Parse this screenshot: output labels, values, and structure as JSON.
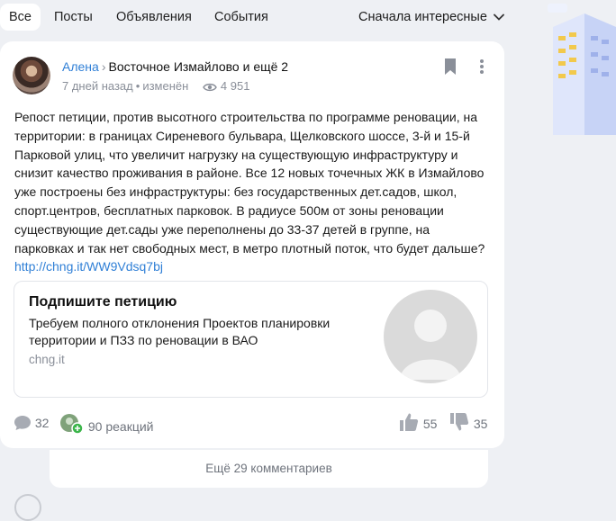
{
  "filters": {
    "tabs": [
      {
        "label": "Все",
        "active": true
      },
      {
        "label": "Посты",
        "active": false
      },
      {
        "label": "Объявления",
        "active": false
      },
      {
        "label": "События",
        "active": false
      }
    ],
    "sort_label": "Сначала интересные"
  },
  "post": {
    "author": "Алена",
    "separator": "›",
    "location": "Восточное Измайлово и ещё 2",
    "age": "7 дней назад",
    "dot": "•",
    "edited": "изменён",
    "views": "4 951",
    "text": "Репост петиции, против высотного строительства по программе реновации, на территории: в границах Сиреневого бульвара, Щелковского шоссе, 3-й и 15-й Парковой улиц, что увеличит нагрузку на существующую инфраструктуру и снизит качество проживания в районе. Все 12 новых точечных ЖК в Измайлово уже построены без инфраструктуры: без государственных дет.садов, школ, спорт.центров, бесплатных парковок. В радиусе 500м от зоны реновации существующие дет.сады уже переполнены до 33-37 детей в группе, на парковках и так нет свободных мест, в метро плотный поток, что будет дальше?",
    "link": "http://chng.it/WW9Vdsq7bj",
    "snippet": {
      "title": "Подпишите петицию",
      "description": "Требуем полного отклонения Проектов планировки территории и ПЗЗ по реновации в ВАО",
      "domain": "chng.it"
    },
    "comments_count": "32",
    "reactions_label": "90 реакций",
    "likes": "55",
    "dislikes": "35",
    "more_comments": "Ещё 29 комментариев"
  },
  "colors": {
    "accent": "#2f7fd6",
    "muted": "#8a8f99",
    "background": "#eef0f4"
  }
}
